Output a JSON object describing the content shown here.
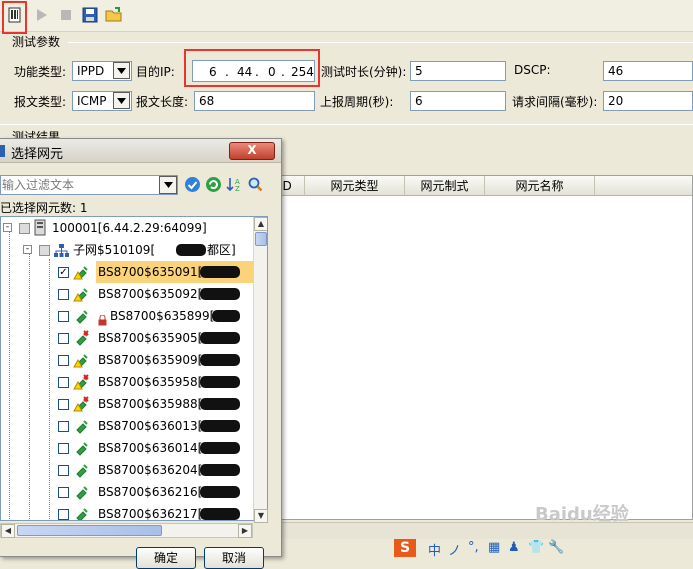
{
  "toolbar": {
    "buttons": [
      "select-ne-icon",
      "play-icon",
      "stop-icon",
      "save-icon",
      "open-folder-icon"
    ]
  },
  "params": {
    "title": "测试参数",
    "func_type_label": "功能类型:",
    "func_type_value": "IPPD",
    "dest_ip_label": "目的IP:",
    "ip": [
      "6",
      "44",
      "0",
      "254"
    ],
    "ip_dot": ".",
    "duration_label": "测试时长(分钟):",
    "duration_value": "5",
    "dscp_label": "DSCP:",
    "dscp_value": "46",
    "packet_type_label": "报文类型:",
    "packet_type_value": "ICMP",
    "packet_len_label": "报文长度:",
    "packet_len_value": "68",
    "report_label": "上报周期(秒):",
    "report_value": "6",
    "interval_label": "请求间隔(毫秒):",
    "interval_value": "20"
  },
  "results": {
    "title": "测试结果",
    "columns": [
      "ID",
      "网元类型",
      "网元制式",
      "网元名称"
    ]
  },
  "dialog": {
    "title": "选择网元",
    "close": "X",
    "filter_placeholder": "输入过滤文本",
    "selected_count": "已选择网元数: 1",
    "tree_root": "100001[6.44.2.29:64099]",
    "subnet": "子网$510109[",
    "subnet_suffix": "都区]",
    "items": [
      {
        "label": "BS8700$635091[L][",
        "checked": true,
        "status": "warn-green"
      },
      {
        "label": "BS8700$635092[L][",
        "checked": false,
        "status": "warn-green"
      },
      {
        "label": "BS8700$635899[L][",
        "checked": false,
        "status": "lock-green"
      },
      {
        "label": "BS8700$635905[L][",
        "checked": false,
        "status": "red-plug"
      },
      {
        "label": "BS8700$635909[L][",
        "checked": false,
        "status": "warn-green"
      },
      {
        "label": "BS8700$635958[L][",
        "checked": false,
        "status": "warn-red"
      },
      {
        "label": "BS8700$635988[L][",
        "checked": false,
        "status": "warn-red"
      },
      {
        "label": "BS8700$636013[L][",
        "checked": false,
        "status": "green"
      },
      {
        "label": "BS8700$636014[L][",
        "checked": false,
        "status": "green"
      },
      {
        "label": "BS8700$636204[L][",
        "checked": false,
        "status": "green"
      },
      {
        "label": "BS8700$636216[L][",
        "checked": false,
        "status": "green"
      },
      {
        "label": "BS8700$636217[L][",
        "checked": false,
        "status": "green"
      }
    ],
    "ok_label": "确定",
    "cancel_label": "取消"
  },
  "taskbar": {
    "ime_items": [
      "中",
      "ノ",
      "°,",
      "▦",
      "♟",
      "👕",
      "🔧"
    ]
  },
  "watermark": "Baidu经验",
  "colors": {
    "accent_red": "#e8352d",
    "selection": "#fbd37b",
    "field_border": "#7f9db9"
  }
}
